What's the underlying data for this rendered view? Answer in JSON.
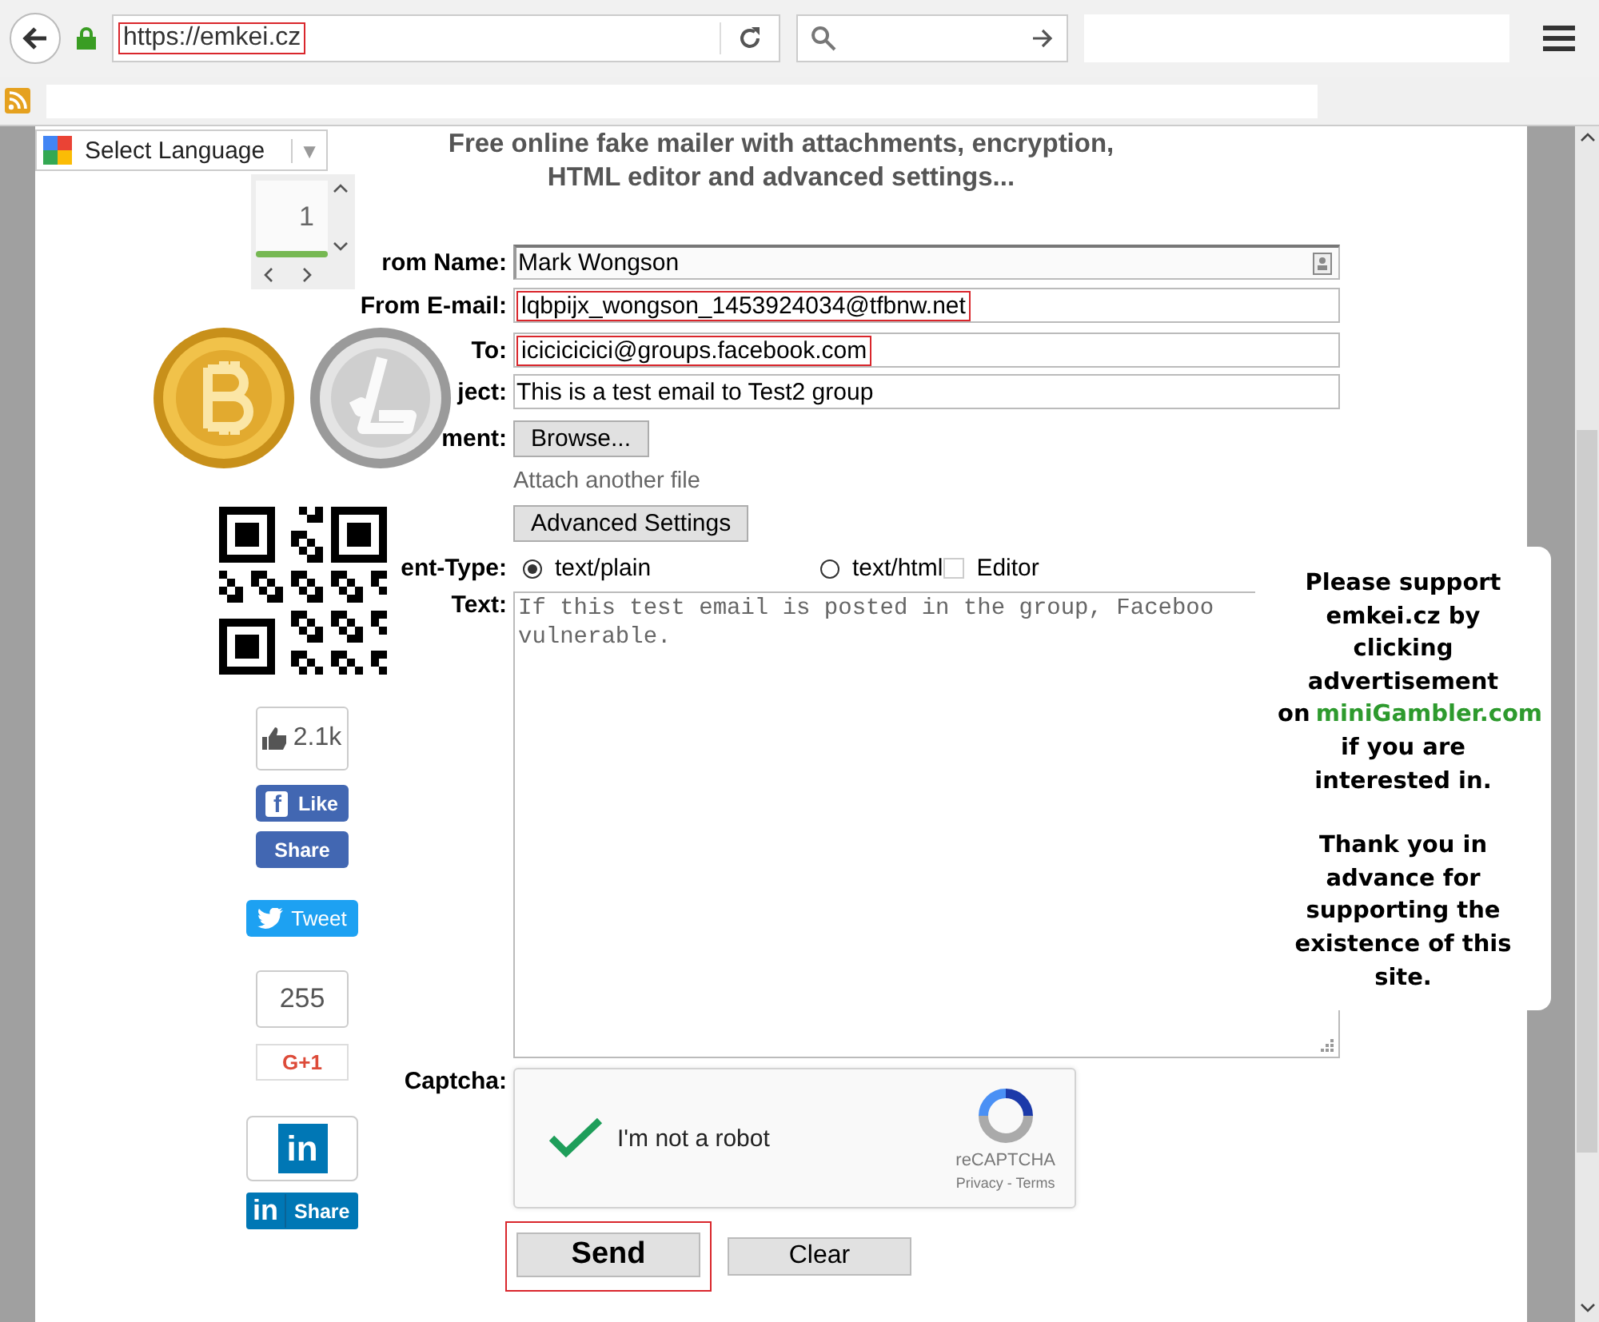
{
  "browser": {
    "url": "https://emkei.cz",
    "url_highlighted": true
  },
  "language": {
    "label": "Select Language",
    "caret": "▼"
  },
  "title": [
    "Free online fake mailer with attachments, encryption,",
    "HTML editor and advanced settings..."
  ],
  "counter": {
    "value": "1"
  },
  "social": {
    "like_count": "2.1k",
    "like": {
      "logo": "f",
      "label": "Like"
    },
    "share": "Share",
    "tweet": "Tweet",
    "plus_count": "255",
    "plus": "G+1",
    "linkedin": {
      "logo": "in",
      "share_logo": "in",
      "label": "Share"
    }
  },
  "form": {
    "fields": [
      {
        "kind": "contact",
        "label": "rom Name:",
        "value": "Mark Wongson",
        "highlighted": false
      },
      {
        "kind": "plain",
        "label": "From E-mail:",
        "value": "lqbpijx_wongson_1453924034@tfbnw.net",
        "highlighted": true
      },
      {
        "kind": "plain",
        "label": "To:",
        "value": "icicicicici@groups.facebook.com",
        "highlighted": true
      },
      {
        "kind": "plain",
        "label": "ject:",
        "value": "This is a test email to Test2 group",
        "highlighted": false
      }
    ],
    "attachment": {
      "label": "ment:",
      "button": "Browse...",
      "link": "Attach another file"
    },
    "advanced_button": "Advanced Settings",
    "content_type": {
      "label": "ent-Type:",
      "options": [
        {
          "kind": "radio",
          "label": "text/plain",
          "selected": true
        },
        {
          "kind": "radio",
          "label": "text/html",
          "selected": false
        },
        {
          "kind": "checkbox",
          "label": "Editor",
          "checked": false
        }
      ]
    },
    "text": {
      "label": "Text:",
      "value": "If this test email is posted in the group, Faceboo\nvulnerable."
    },
    "captcha": {
      "label": "Captcha:",
      "checked": true,
      "text": "I'm not a robot",
      "brand": "reCAPTCHA",
      "links": "Privacy - Terms"
    },
    "buttons": [
      {
        "kind": "send",
        "label": "Send",
        "highlighted": true
      },
      {
        "kind": "clear",
        "label": "Clear",
        "highlighted": false
      }
    ]
  },
  "ad": {
    "paragraphs": [
      {
        "text": "Please support emkei.cz by clicking advertisement on",
        "link": "miniGambler.com",
        "tail": "if you are interested in."
      },
      {
        "text": "Thank you in advance for supporting the existence of this site."
      }
    ]
  }
}
